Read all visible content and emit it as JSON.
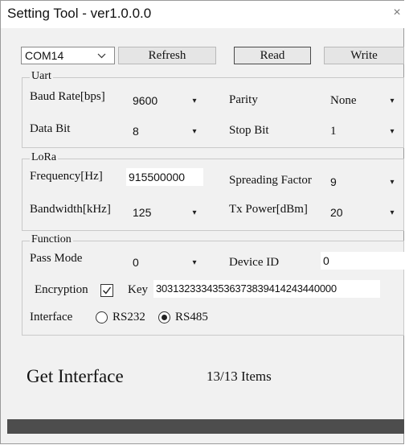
{
  "window": {
    "title": "Setting Tool - ver1.0.0.0",
    "close_glyph": "×"
  },
  "toolbar": {
    "port": "COM14",
    "refresh": "Refresh",
    "read": "Read",
    "write": "Write"
  },
  "uart": {
    "title": "Uart",
    "baud_label": "Baud Rate[bps]",
    "baud_value": "9600",
    "parity_label": "Parity",
    "parity_value": "None",
    "databit_label": "Data Bit",
    "databit_value": "8",
    "stopbit_label": "Stop Bit",
    "stopbit_value": "1"
  },
  "lora": {
    "title": "LoRa",
    "freq_label": "Frequency[Hz]",
    "freq_value": "915500000",
    "sf_label": "Spreading Factor",
    "sf_value": "9",
    "bw_label": "Bandwidth[kHz]",
    "bw_value": "125",
    "tx_label": "Tx Power[dBm]",
    "tx_value": "20"
  },
  "function": {
    "title": "Function",
    "pass_label": "Pass Mode",
    "pass_value": "0",
    "devid_label": "Device ID",
    "devid_value": "0",
    "enc_label": "Encryption",
    "enc_checked": true,
    "key_label": "Key",
    "key_value": "30313233343536373839414243440000",
    "iface_label": "Interface",
    "rs232": "RS232",
    "rs485": "RS485",
    "selected": "RS485"
  },
  "status": {
    "title": "Get Interface",
    "items": "13/13 Items"
  }
}
